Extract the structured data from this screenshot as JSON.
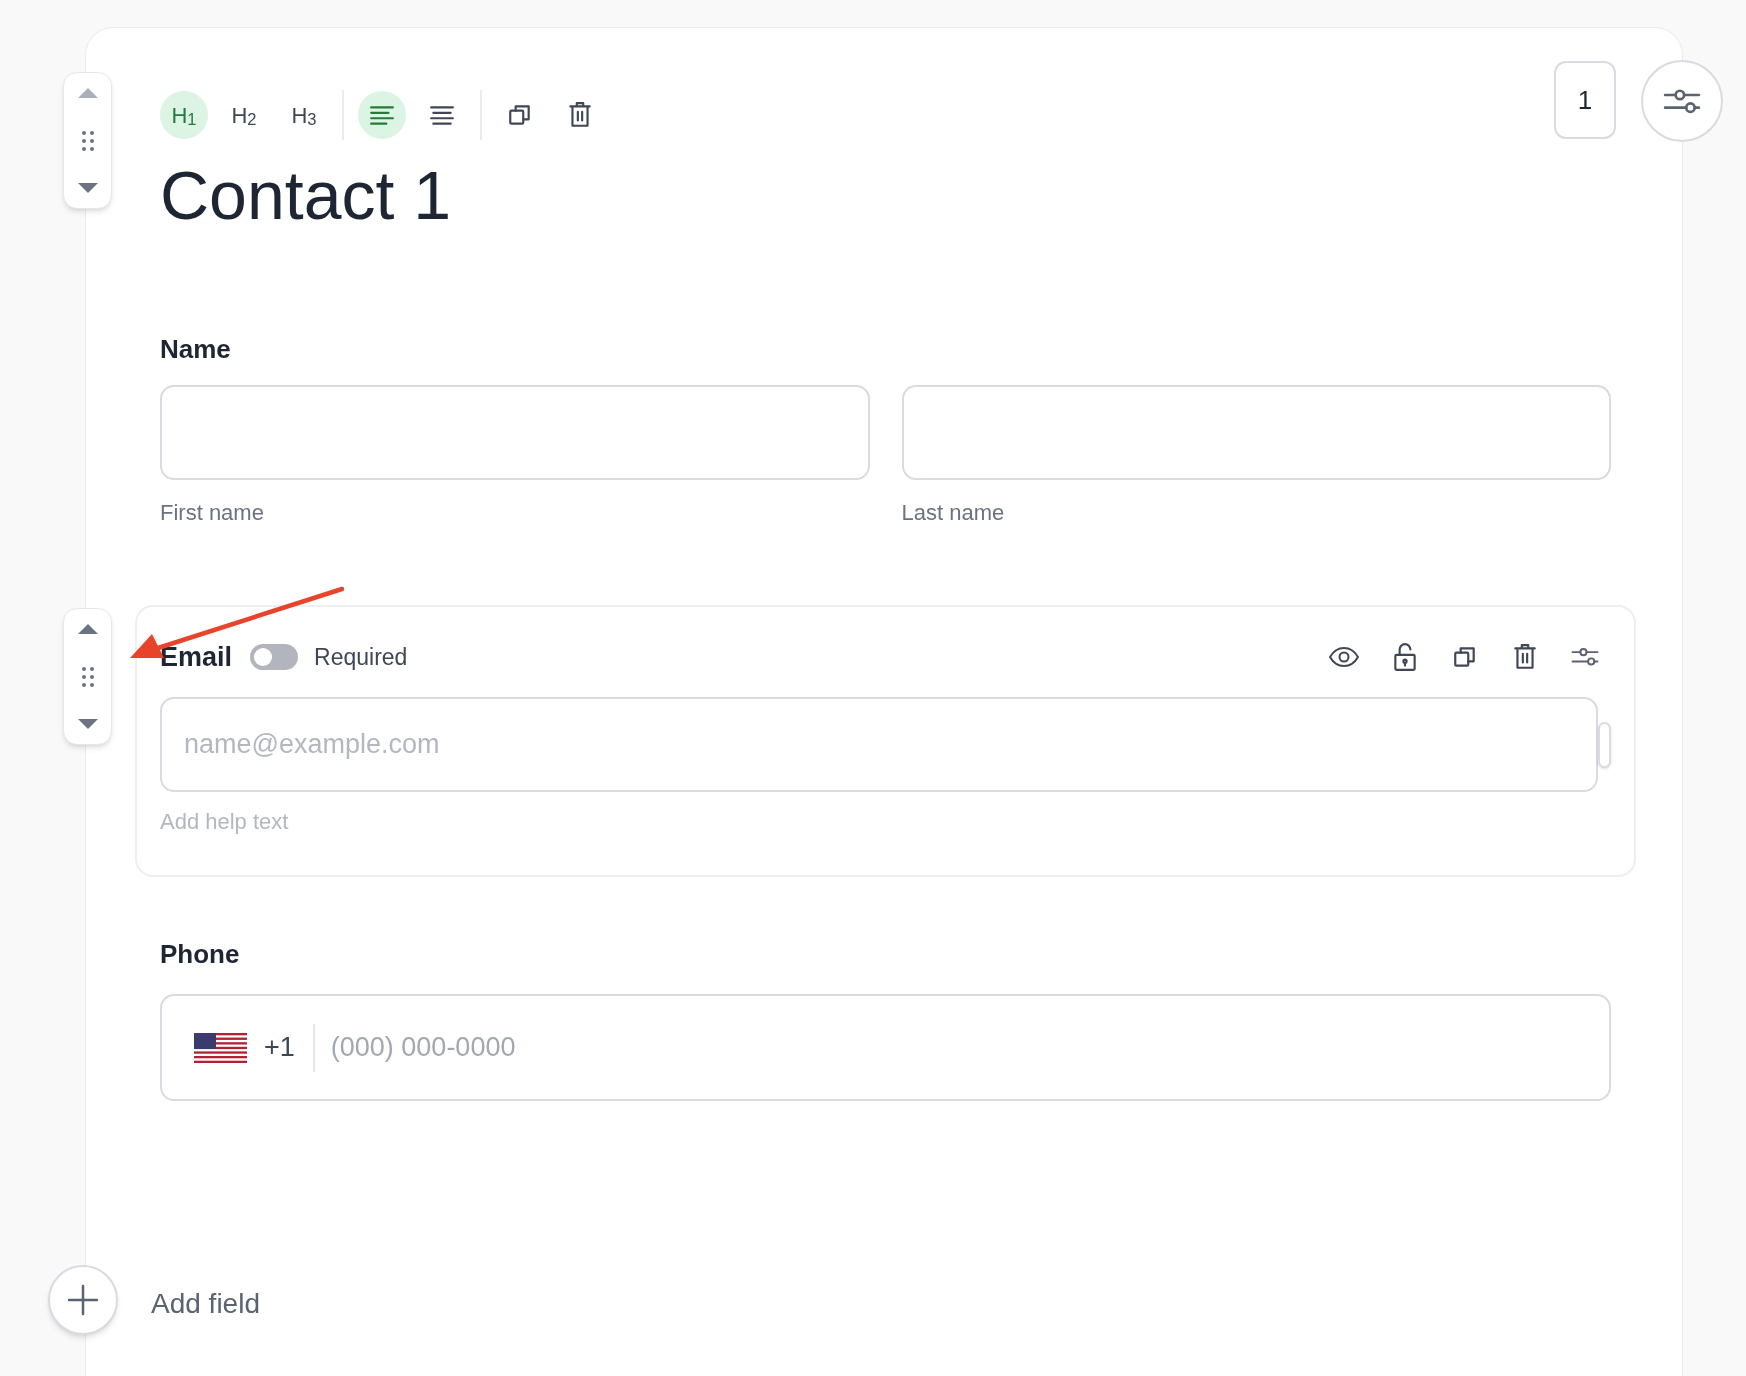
{
  "toolbar": [
    {
      "kind": "heading",
      "label": "H$_{1}$",
      "selected": true
    },
    {
      "kind": "heading",
      "label": "H$_{2}$",
      "selected": false
    },
    {
      "kind": "heading",
      "label": "H$_{3}$",
      "selected": false
    },
    {
      "kind": "align-left",
      "selected": true
    },
    {
      "kind": "align-center",
      "selected": false
    },
    {
      "kind": "copy"
    },
    {
      "kind": "delete"
    }
  ],
  "title": "Contact 1",
  "page_number": "1",
  "name_field": {
    "label": "Name",
    "first_sublabel": "First name",
    "last_sublabel": "Last name"
  },
  "email_field": {
    "label": "Email",
    "required_label": "Required",
    "required": false,
    "placeholder": "name@example.com",
    "help_placeholder": "Add help text"
  },
  "phone_field": {
    "label": "Phone",
    "country_code": "+1",
    "placeholder": "(000) 000-0000"
  },
  "add_field": "Add field"
}
